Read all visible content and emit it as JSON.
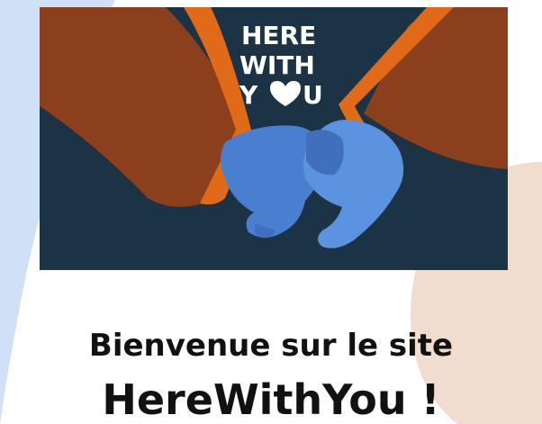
{
  "hero": {
    "logo_line1": "HERE",
    "logo_line2_part1": "WITH",
    "logo_line3_y": "Y",
    "logo_line3_u": "U",
    "colors": {
      "background": "#1b3345",
      "sleeve": "#8b3f1c",
      "cuff": "#e06a18",
      "glove": "#4a7fd0",
      "glove_light": "#5b93e0"
    }
  },
  "welcome": {
    "line1": "Bienvenue sur le site",
    "line2": "HereWithYou !"
  },
  "colors": {
    "bg_blue": "#cfe0f7",
    "bg_peach": "#f0ddd0",
    "text": "#111111"
  }
}
